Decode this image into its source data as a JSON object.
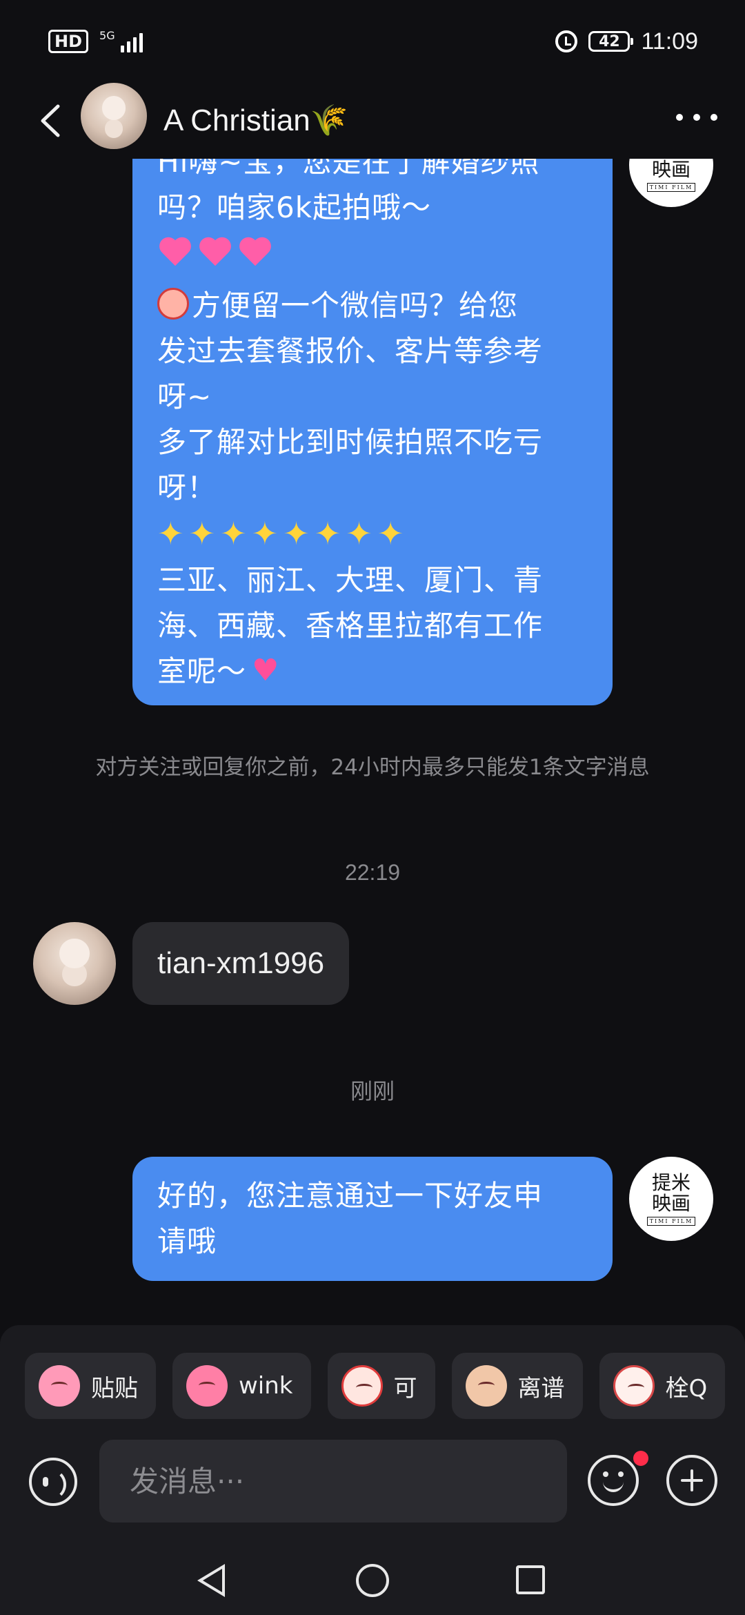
{
  "status_bar": {
    "hd": "HD",
    "network": "5G",
    "battery": "42",
    "time": "11:09"
  },
  "header": {
    "contact_name": "A  Christian🌾"
  },
  "messages": {
    "top_bubble": {
      "partial_line": "Hi嗨~宝，您是在了解婚纱照",
      "line2": "吗？咱家6k起拍哦～",
      "line4": "方便留一个微信吗？给您",
      "line5": "发过去套餐报价、客片等参考",
      "line6": "呀~",
      "line7": "多了解对比到时候拍照不吃亏",
      "line8": "呀！",
      "line10": "三亚、丽江、大理、厦门、青",
      "line11": "海、西藏、香格里拉都有工作",
      "line12": "室呢～"
    },
    "system_note": "对方关注或回复你之前，24小时内最多只能发1条文字消息",
    "time_1": "22:19",
    "incoming_text": "tian-xm1996",
    "time_2": "刚刚",
    "bottom_bubble": {
      "line1": "好的，您注意通过一下好友申",
      "line2": "请哦"
    },
    "brand_avatar": {
      "main": "提米映画",
      "sub": "TIMI FILM"
    }
  },
  "quick_replies": [
    {
      "label": "贴贴",
      "icon": "sticker-hug-icon"
    },
    {
      "label": "wink",
      "icon": "sticker-wink-icon"
    },
    {
      "label": "可",
      "icon": "sticker-ok-icon"
    },
    {
      "label": "离谱",
      "icon": "sticker-facepalm-icon"
    },
    {
      "label": "栓Q",
      "icon": "sticker-thankyou-icon"
    }
  ],
  "input": {
    "placeholder": "发消息···"
  },
  "colors": {
    "background": "#0f0f12",
    "outgoing_bubble": "#4a8cf0",
    "incoming_bubble": "#2a2a2e",
    "badge_red": "#ff2d4a"
  }
}
